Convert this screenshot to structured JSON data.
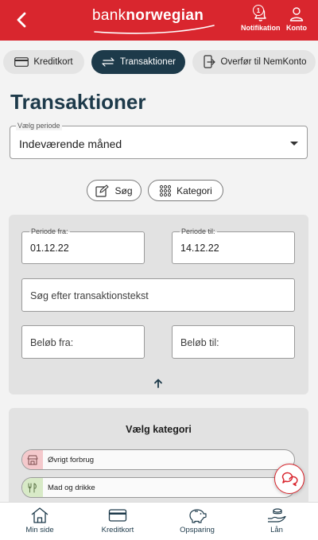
{
  "header": {
    "logo_regular": "bank",
    "logo_bold": "norwegian",
    "notification_label": "Notifikation",
    "notification_count": "1",
    "account_label": "Konto",
    "icons": {
      "back": "chevron-left-icon",
      "notification": "bell-icon",
      "account": "person-icon"
    }
  },
  "tabs": [
    {
      "label": "Kreditkort",
      "icon": "credit-card-icon",
      "active": false
    },
    {
      "label": "Transaktioner",
      "icon": "transfer-arrows-icon",
      "active": true
    },
    {
      "label": "Overfør til NemKonto",
      "icon": "phone-transfer-icon",
      "active": false
    }
  ],
  "page": {
    "title": "Transaktioner"
  },
  "period": {
    "label": "Vælg periode",
    "value": "Indeværende måned"
  },
  "actions": {
    "search_label": "Søg",
    "category_label": "Kategori"
  },
  "filters": {
    "period_from_label": "Periode fra:",
    "period_from_value": "01.12.22",
    "period_to_label": "Periode til:",
    "period_to_value": "14.12.22",
    "text_placeholder": "Søg efter transaktionstekst",
    "amount_from_placeholder": "Beløb fra:",
    "amount_to_placeholder": "Beløb til:"
  },
  "categories": {
    "title": "Vælg kategori",
    "items": [
      {
        "label": "Øvrigt forbrug",
        "icon": "shop-icon",
        "color": "#f4c9cc"
      },
      {
        "label": "Mad og drikke",
        "icon": "food-icon",
        "color": "#d8eac7"
      }
    ]
  },
  "bottom_nav": [
    {
      "label": "Min side",
      "icon": "home-icon"
    },
    {
      "label": "Kreditkort",
      "icon": "credit-card-icon"
    },
    {
      "label": "Opsparing",
      "icon": "piggy-bank-icon"
    },
    {
      "label": "Lån",
      "icon": "loan-hand-icon"
    }
  ],
  "colors": {
    "brand": "#d9262e",
    "accent": "#1d3a4a",
    "background": "#f3f3f3"
  }
}
